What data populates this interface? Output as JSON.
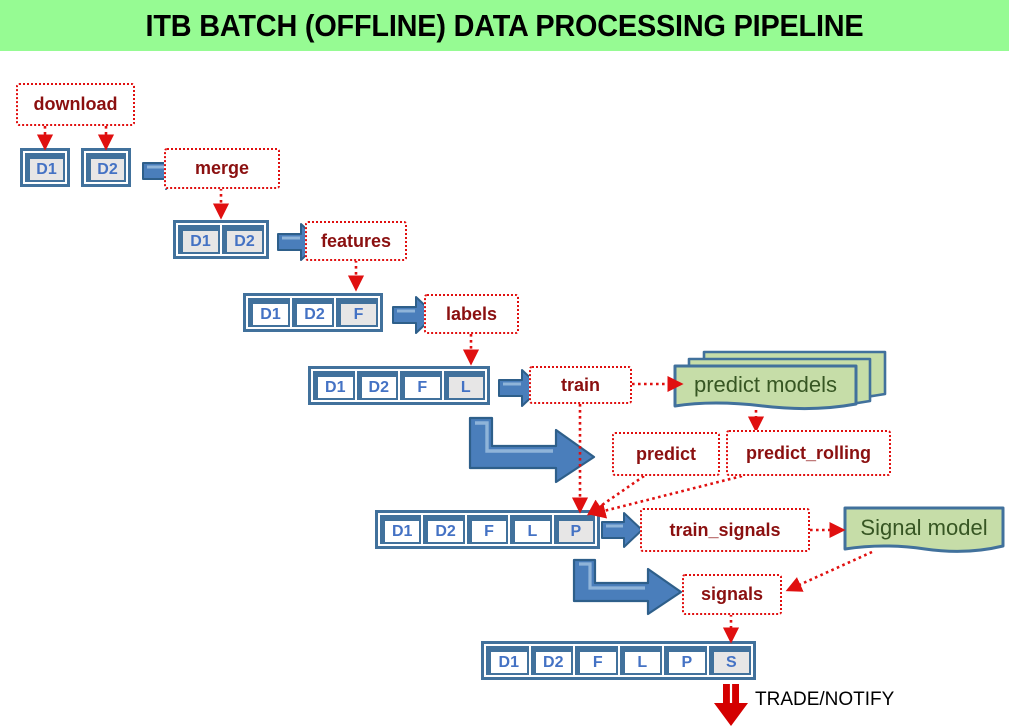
{
  "title": "ITB BATCH (OFFLINE) DATA PROCESSING PIPELINE",
  "theme": {
    "banner_green": "#96FB93",
    "process_red": "#E01010",
    "process_text": "#8B1010",
    "table_blue": "#41719C",
    "cell_label_blue": "#4472C4",
    "cell_fill_gray": "#E7E6E6",
    "arrow_blue": "#4A7EBB",
    "model_green": "#C6DDA8",
    "model_text": "#375623",
    "trade_arrow_red": "#D40000"
  },
  "processes": {
    "download": "download",
    "merge": "merge",
    "features": "features",
    "labels": "labels",
    "train": "train",
    "predict": "predict",
    "predict_rolling": "predict_rolling",
    "train_signals": "train_signals",
    "signals": "signals"
  },
  "models": {
    "predict_models": "predict models",
    "signal_model": "Signal model"
  },
  "datasets": [
    {
      "name": "raw-d1",
      "columns": [
        {
          "label": "D1",
          "filled": true
        }
      ]
    },
    {
      "name": "raw-d2",
      "columns": [
        {
          "label": "D2",
          "filled": true
        }
      ]
    },
    {
      "name": "merged",
      "columns": [
        {
          "label": "D1",
          "filled": true
        },
        {
          "label": "D2",
          "filled": true
        }
      ]
    },
    {
      "name": "featured",
      "columns": [
        {
          "label": "D1",
          "filled": false
        },
        {
          "label": "D2",
          "filled": false
        },
        {
          "label": "F",
          "filled": true
        }
      ]
    },
    {
      "name": "labeled",
      "columns": [
        {
          "label": "D1",
          "filled": false
        },
        {
          "label": "D2",
          "filled": false
        },
        {
          "label": "F",
          "filled": false
        },
        {
          "label": "L",
          "filled": true
        }
      ]
    },
    {
      "name": "predicted",
      "columns": [
        {
          "label": "D1",
          "filled": false
        },
        {
          "label": "D2",
          "filled": false
        },
        {
          "label": "F",
          "filled": false
        },
        {
          "label": "L",
          "filled": false
        },
        {
          "label": "P",
          "filled": true
        }
      ]
    },
    {
      "name": "signaled",
      "columns": [
        {
          "label": "D1",
          "filled": false
        },
        {
          "label": "D2",
          "filled": false
        },
        {
          "label": "F",
          "filled": false
        },
        {
          "label": "L",
          "filled": false
        },
        {
          "label": "P",
          "filled": false
        },
        {
          "label": "S",
          "filled": true
        }
      ]
    }
  ],
  "output": {
    "label": "TRADE/NOTIFY"
  }
}
